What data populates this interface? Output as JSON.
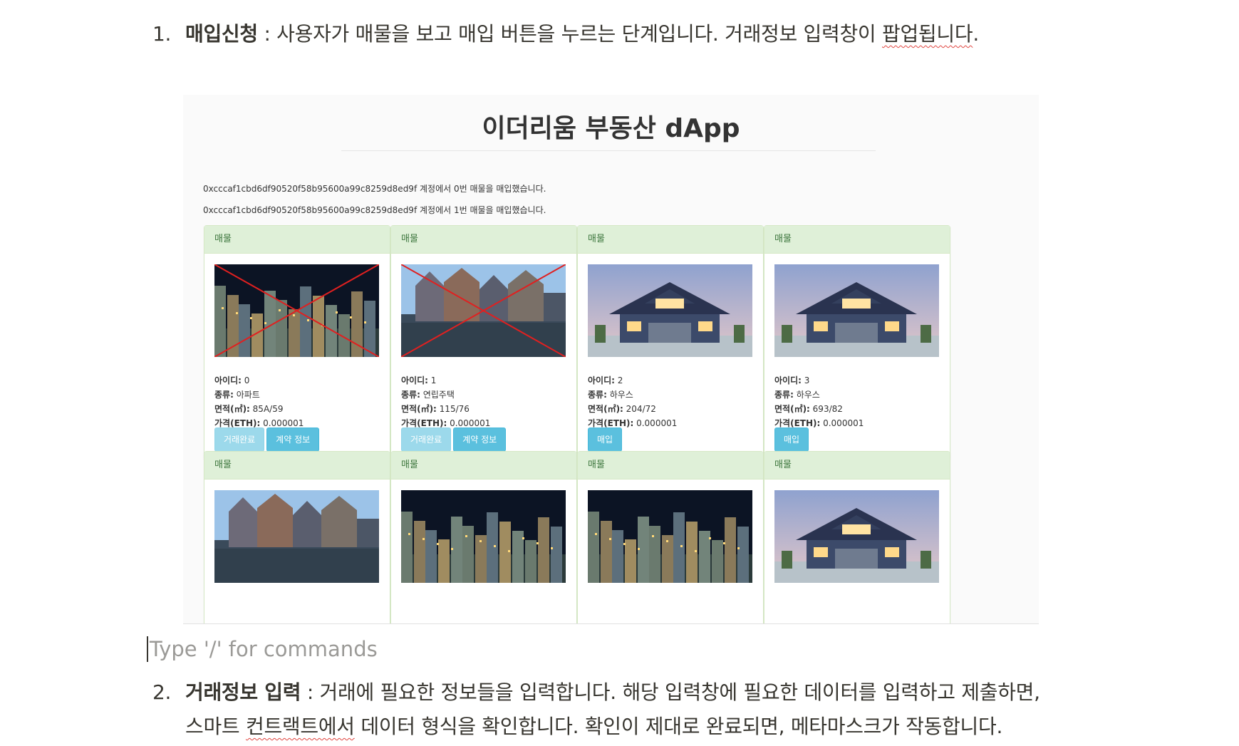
{
  "steps": [
    {
      "num": "1.",
      "title": "매입신청",
      "text_before_spell": " : 사용자가 매물을 보고 매입 버튼을 누르는 단계입니다. 거래정보 입력창이 ",
      "spell_word": "팝업됩니다",
      "text_after_spell": "."
    },
    {
      "num": "2.",
      "title": "거래정보 입력",
      "line1": " : 거래에 필요한 정보들을 입력합니다. 해당 입력창에 필요한 데이터를 입력하고 제출하면,",
      "line2_before": "스마트 ",
      "line2_spell": "컨트랙트에서",
      "line2_after": " 데이터 형식을 확인합니다. 확인이 제대로 완료되면, 메타마스크가 작동합니다."
    }
  ],
  "editor": {
    "placeholder": "Type '/' for commands"
  },
  "dapp": {
    "title": "이더리움 부동산 dApp",
    "logs": [
      "0xcccaf1cbd6df90520f58b95600a99c8259d8ed9f 계정에서 0번 매물을 매입했습니다.",
      "0xcccaf1cbd6df90520f58b95600a99c8259d8ed9f 계정에서 1번 매물을 매입했습니다."
    ],
    "labels": {
      "header": "매물",
      "id": "아이디:",
      "type": "종류:",
      "area": "면적(㎡):",
      "price": "가격(ETH):"
    },
    "listings": [
      {
        "id": "0",
        "type": "아파트",
        "area": "85A/59",
        "price": "0.000001",
        "image": "city-night-icon",
        "sold": true,
        "buttons": [
          "거래완료",
          "계약 정보"
        ]
      },
      {
        "id": "1",
        "type": "연립주택",
        "area": "115/76",
        "price": "0.000001",
        "image": "canal-houses-icon",
        "sold": true,
        "buttons": [
          "거래완료",
          "계약 정보"
        ]
      },
      {
        "id": "2",
        "type": "하우스",
        "area": "204/72",
        "price": "0.000001",
        "image": "house-icon",
        "sold": false,
        "buttons": [
          "매입"
        ]
      },
      {
        "id": "3",
        "type": "하우스",
        "area": "693/82",
        "price": "0.000001",
        "image": "house-icon",
        "sold": false,
        "buttons": [
          "매입"
        ]
      },
      {
        "image": "canal-houses-icon"
      },
      {
        "image": "city-night-icon"
      },
      {
        "image": "city-night-icon"
      },
      {
        "image": "house-icon"
      }
    ]
  }
}
